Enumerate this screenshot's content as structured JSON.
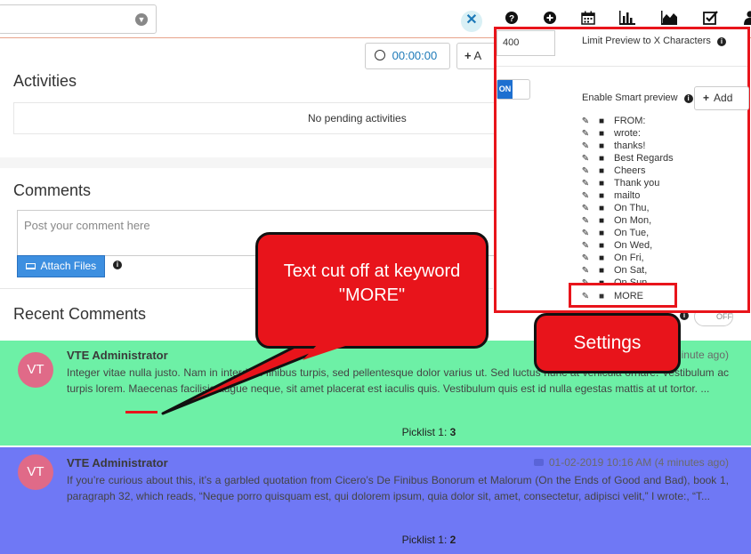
{
  "topbar": {
    "timer": "00:00:00",
    "add_label": "A",
    "icons": [
      "vte-x-logo",
      "help-icon",
      "plus-circle-icon",
      "calendar-icon",
      "bar-chart-icon",
      "area-chart-icon",
      "checkbox-icon",
      "user-icon"
    ]
  },
  "activities": {
    "title": "Activities",
    "empty_text": "No pending activities"
  },
  "comments_section": {
    "title": "Comments",
    "placeholder": "Post your comment here",
    "attach_label": "Attach Files"
  },
  "recent": {
    "title": "Recent Comments",
    "toggle_label": "OFF",
    "items": [
      {
        "avatar": "VT",
        "author": "VTE Administrator",
        "time": "inute ago)",
        "body": "Integer vitae nulla justo. Nam in interdum finibus turpis, sed pellentesque dolor varius ut. Sed luctus nunc at vehicula ornare. Vestibulum ac turpis lorem. Maecenas facilisis augue neque, sit amet placerat est iaculis quis. Vestibulum quis est id nulla egestas mattis at ut tortor. ...",
        "picklist_label": "Picklist 1: ",
        "picklist_value": "3",
        "color": "#6df0a6"
      },
      {
        "avatar": "VT",
        "author": "VTE Administrator",
        "time": "01-02-2019 10:16 AM (4 minutes ago)",
        "body": "If you’re curious about this, it’s a garbled quotation from Cicero’s De Finibus Bonorum et Malorum (On the Ends of Good and Bad), book 1, paragraph 32, which reads, “Neque porro quisquam est, qui dolorem ipsum, quia dolor sit, amet, consectetur, adipisci velit,” I wrote:, “T...",
        "picklist_label": "Picklist 1: ",
        "picklist_value": "2",
        "color": "#6f78f5"
      }
    ]
  },
  "settings": {
    "limit_value": "400",
    "limit_label": "Limit Preview to X Characters",
    "toggle_label": "ON",
    "smart_label": "Enable Smart preview",
    "add_label": "Add",
    "keywords": [
      "FROM:",
      "wrote:",
      "thanks!",
      "Best Regards",
      "Cheers",
      "Thank you",
      "mailto",
      "On Thu,",
      "On Mon,",
      "On Tue,",
      "On Wed,",
      "On Fri,",
      "On Sat,",
      "On Sun"
    ],
    "highlighted_keyword": "MORE"
  },
  "callouts": {
    "text_cut": "Text cut off at keyword \"MORE\"",
    "settings": "Settings"
  },
  "colors": {
    "accent_red": "#e8141b",
    "primary_blue": "#3d8fe0",
    "green_card": "#6df0a6",
    "blue_card": "#6f78f5"
  }
}
